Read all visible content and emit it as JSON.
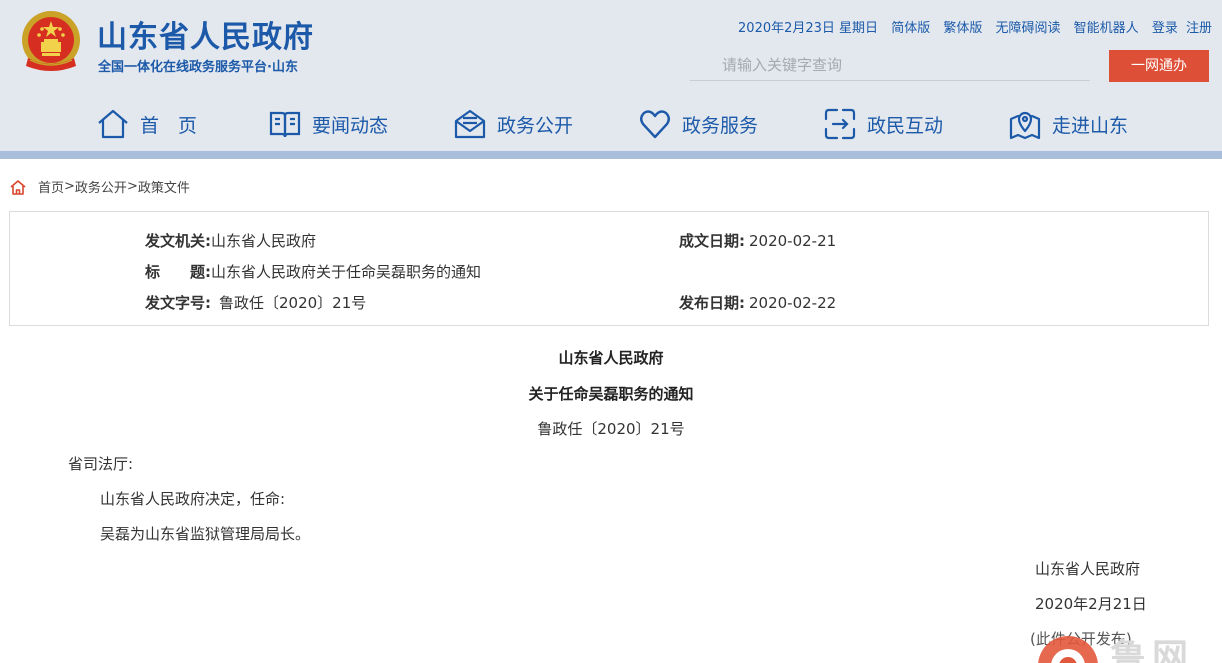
{
  "header": {
    "site_title": "山东省人民政府",
    "site_subtitle": "全国一体化在线政务服务平台·山东",
    "topbar": {
      "date": "2020年2月23日 星期日",
      "simplified": "简体版",
      "traditional": "繁体版",
      "accessible": "无障碍阅读",
      "robot": "智能机器人",
      "login": "登录",
      "register": "注册"
    },
    "search_placeholder": "请输入关键字查询",
    "wangban_label": "一网通办"
  },
  "nav": {
    "items": [
      {
        "label": "首　页",
        "icon": "home-icon"
      },
      {
        "label": "要闻动态",
        "icon": "book-icon"
      },
      {
        "label": "政务公开",
        "icon": "mail-icon"
      },
      {
        "label": "政务服务",
        "icon": "heart-icon"
      },
      {
        "label": "政民互动",
        "icon": "interaction-icon"
      },
      {
        "label": "走进山东",
        "icon": "map-pin-icon"
      }
    ]
  },
  "breadcrumb": {
    "home": "首页",
    "sep1": ">",
    "level2": "政务公开",
    "sep2": ">",
    "level3": "政策文件"
  },
  "info": {
    "issuer_label": "发文机关:",
    "issuer_value": "山东省人民政府",
    "date_label": "成文日期:",
    "date_value": "2020-02-21",
    "title_label": "标　　题:",
    "title_value": "山东省人民政府关于任命吴磊职务的通知",
    "docno_label": "发文字号:",
    "docno_value": "鲁政任〔2020〕21号",
    "publish_label": "发布日期:",
    "publish_value": "2020-02-22"
  },
  "document": {
    "title1": "山东省人民政府",
    "title2": "关于任命吴磊职务的通知",
    "doc_number": "鲁政任〔2020〕21号",
    "addressee": "省司法厅:",
    "para1": "山东省人民政府决定，任命:",
    "para2": "吴磊为山东省监狱管理局局长。",
    "signature": "山东省人民政府",
    "sign_date": "2020年2月21日",
    "note": "(此件公开发布)"
  },
  "watermark": {
    "text": "鲁网"
  },
  "colors": {
    "brand_blue": "#1c5aa9",
    "header_bg": "#e3e8ef",
    "accent_red": "#dd4f36",
    "nav_strip": "#a9bedb"
  }
}
